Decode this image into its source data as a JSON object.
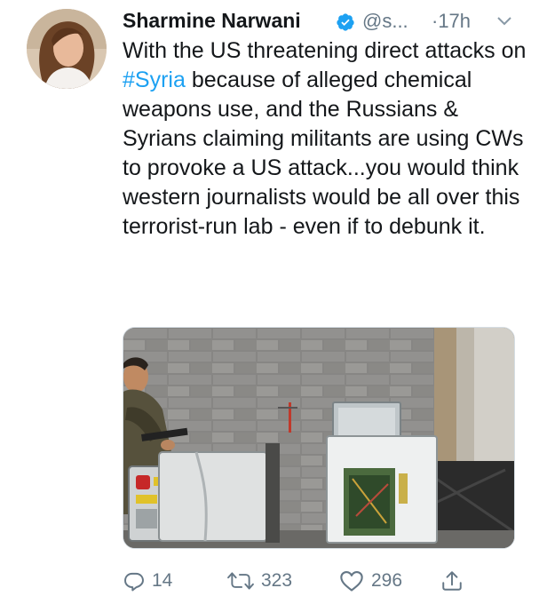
{
  "tweet": {
    "author_name": "Sharmine Narwani",
    "handle": "@s...",
    "time": "·17h",
    "text_before": "With the US threatening direct attacks on ",
    "hashtag": "#Syria",
    "text_after": " because of alleged chemical weapons use, and the Russians & Syrians claiming militants are using CWs to provoke a US attack...you would think western journalists would be all over this terrorist-run lab - even if to debunk it.",
    "replies": "14",
    "retweets": "323",
    "likes": "296"
  },
  "colors": {
    "link": "#1da1f2",
    "verified": "#1da1f2",
    "secondary_text": "#657786"
  },
  "icons": [
    "verified-badge-icon",
    "chevron-down-icon",
    "reply-icon",
    "retweet-icon",
    "like-icon",
    "share-icon"
  ]
}
